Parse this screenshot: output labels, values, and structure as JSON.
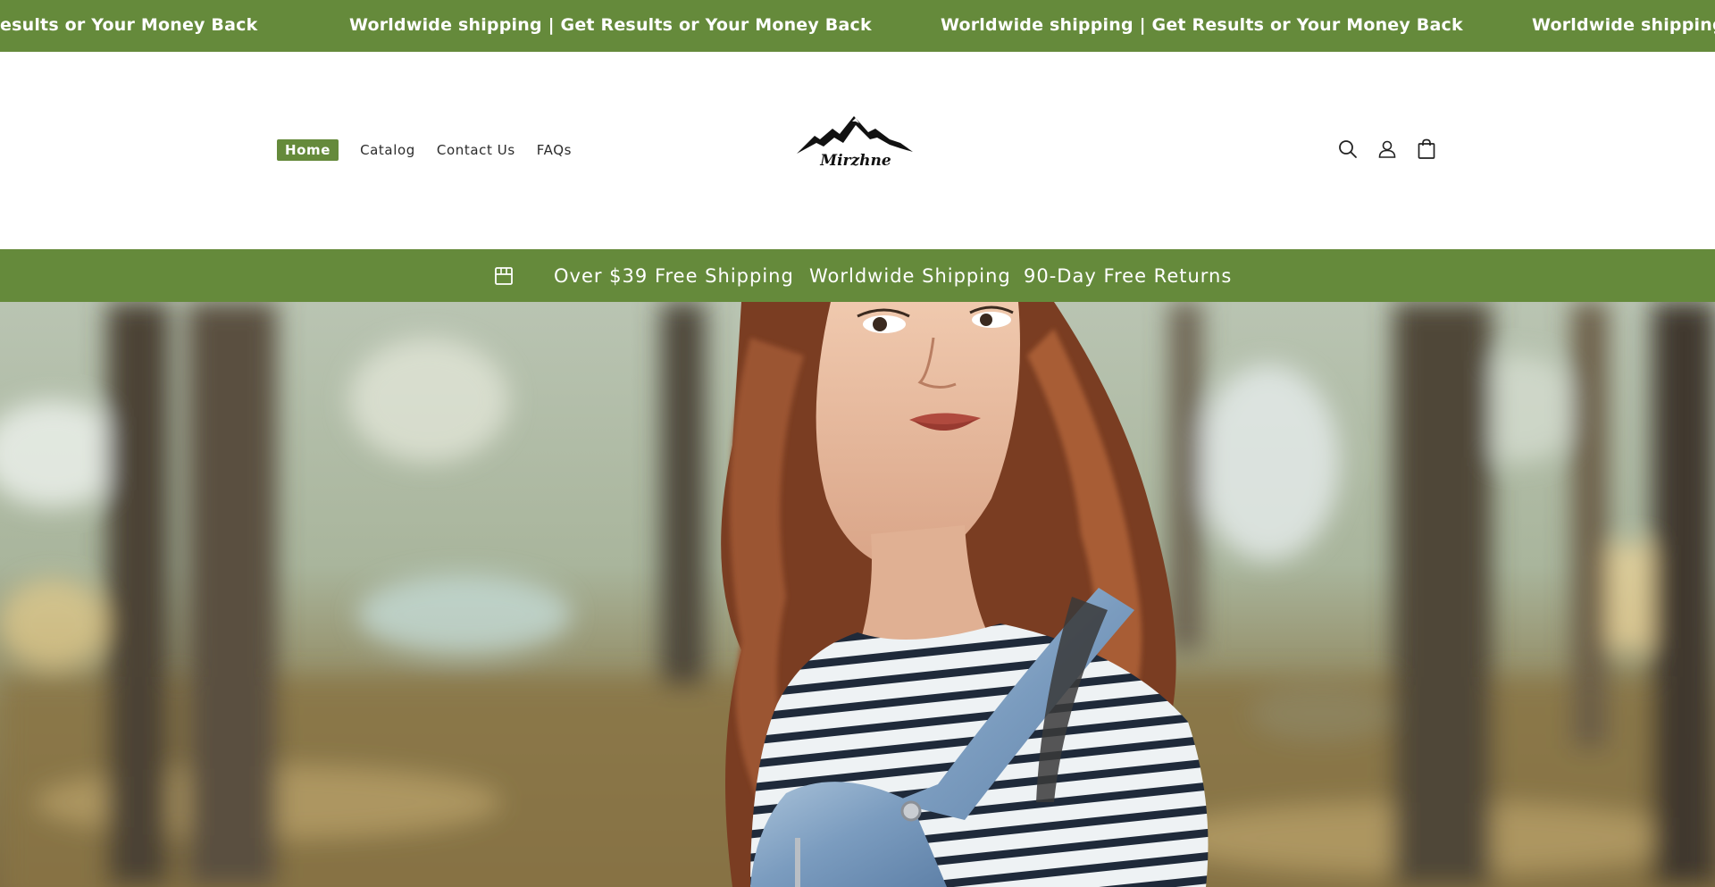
{
  "announcement": {
    "items": [
      "esults or Your Money Back",
      "Worldwide shipping | Get Results or Your Money Back",
      "Worldwide shipping | Get Results or Your Money Back",
      "Worldwide shipping"
    ]
  },
  "nav": {
    "items": [
      "Home",
      "Catalog",
      "Contact Us",
      "FAQs"
    ],
    "active": "Home"
  },
  "logo": {
    "text": "Mirzhne",
    "icon": "mountain-logo-icon"
  },
  "header_icons": [
    "search-icon",
    "account-icon",
    "cart-icon"
  ],
  "benefits": {
    "icon": "store-icon",
    "items": [
      "Over $39 Free Shipping",
      "Worldwide Shipping",
      "90-Day Free Returns"
    ]
  },
  "hero": {
    "image": "woman-in-striped-shirt-and-denim-overalls-in-forest"
  },
  "colors": {
    "brand_green": "#658a3b",
    "text_dark": "#2b2b2b",
    "white": "#ffffff"
  }
}
